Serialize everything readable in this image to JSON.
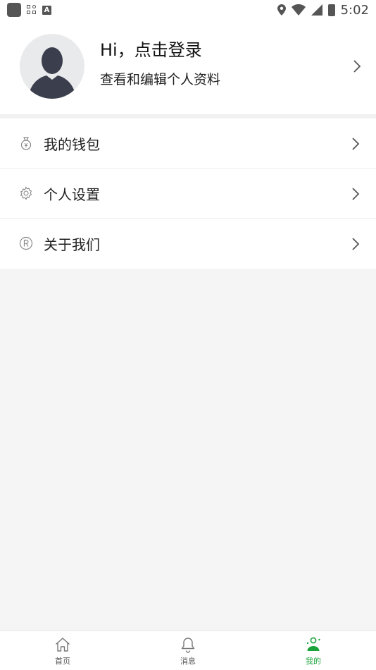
{
  "status_bar": {
    "time": "5:02",
    "left_icons": [
      "app-square-icon",
      "apps-grid-icon",
      "a-badge-icon"
    ],
    "right_icons": [
      "location-icon",
      "wifi-icon",
      "signal-icon",
      "battery-icon"
    ],
    "a_badge": "A"
  },
  "profile": {
    "greeting": "Hi，点击登录",
    "subtitle": "查看和编辑个人资料",
    "avatar_icon": "avatar-placeholder-icon",
    "chevron_icon": "chevron-right-icon"
  },
  "menu": {
    "items": [
      {
        "label": "我的钱包",
        "icon": "wallet-icon"
      },
      {
        "label": "个人设置",
        "icon": "gear-icon"
      },
      {
        "label": "关于我们",
        "icon": "registered-icon"
      }
    ]
  },
  "bottom_nav": {
    "items": [
      {
        "label": "首页",
        "icon": "home-icon",
        "active": false
      },
      {
        "label": "消息",
        "icon": "bell-icon",
        "active": false
      },
      {
        "label": "我的",
        "icon": "profile-icon",
        "active": true
      }
    ]
  },
  "colors": {
    "accent": "#1aa33a",
    "background": "#f5f5f5",
    "card": "#ffffff",
    "avatar_fill": "#3b3f4d",
    "text_primary": "#222222",
    "icon_gray": "#888888"
  }
}
